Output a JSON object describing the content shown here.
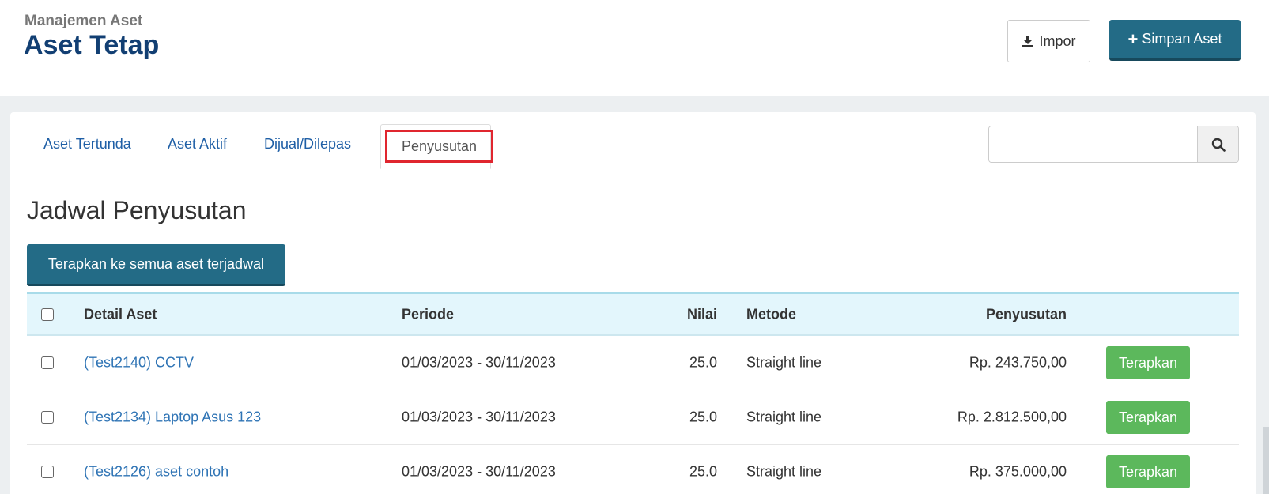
{
  "header": {
    "breadcrumb": "Manajemen Aset",
    "title": "Aset Tetap",
    "import_label": "Impor",
    "save_label": "Simpan Aset"
  },
  "tabs": [
    {
      "label": "Aset Tertunda",
      "active": false
    },
    {
      "label": "Aset Aktif",
      "active": false
    },
    {
      "label": "Dijual/Dilepas",
      "active": false
    },
    {
      "label": "Penyusutan",
      "active": true
    }
  ],
  "search": {
    "placeholder": "",
    "value": ""
  },
  "section": {
    "title": "Jadwal Penyusutan",
    "apply_all_label": "Terapkan ke semua aset terjadwal"
  },
  "table": {
    "headers": {
      "detail": "Detail Aset",
      "period": "Periode",
      "value": "Nilai",
      "method": "Metode",
      "depreciation": "Penyusutan"
    },
    "rows": [
      {
        "detail": "(Test2140) CCTV",
        "period": "01/03/2023 - 30/11/2023",
        "value": "25.0",
        "method": "Straight line",
        "depreciation": "Rp. 243.750,00",
        "action": "Terapkan"
      },
      {
        "detail": "(Test2134) Laptop Asus 123",
        "period": "01/03/2023 - 30/11/2023",
        "value": "25.0",
        "method": "Straight line",
        "depreciation": "Rp. 2.812.500,00",
        "action": "Terapkan"
      },
      {
        "detail": "(Test2126) aset contoh",
        "period": "01/03/2023 - 30/11/2023",
        "value": "25.0",
        "method": "Straight line",
        "depreciation": "Rp. 375.000,00",
        "action": "Terapkan"
      }
    ]
  },
  "colors": {
    "primary": "#236b86",
    "title": "#123f73",
    "link": "#2f74b5",
    "success": "#5cb85c",
    "highlight": "#e0262f",
    "table_header_bg": "#e3f6fc"
  },
  "icons": {
    "import": "download-icon",
    "save": "plus-icon",
    "search": "search-icon"
  }
}
